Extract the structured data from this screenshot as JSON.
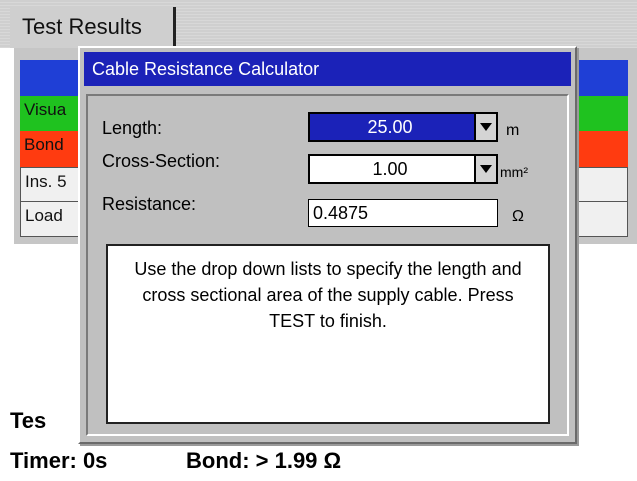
{
  "tab": {
    "label": "Test Results"
  },
  "background_rows": [
    {
      "label": ""
    },
    {
      "label": "Visua"
    },
    {
      "label": "Bond"
    },
    {
      "label": "Ins. 5"
    },
    {
      "label": "Load"
    }
  ],
  "status": {
    "test": "Tes",
    "timer": "Timer: 0s",
    "bond": "Bond: > 1.99 Ω"
  },
  "dialog": {
    "title": "Cable Resistance Calculator",
    "length": {
      "label": "Length:",
      "value": "25.00",
      "unit": "m"
    },
    "cross_section": {
      "label": "Cross-Section:",
      "value": "1.00",
      "unit": "mm²"
    },
    "resistance": {
      "label": "Resistance:",
      "value": "0.4875",
      "unit": "Ω"
    },
    "info": "Use the drop down lists to specify the length and cross sectional area of the supply cable.  Press TEST to finish."
  },
  "colors": {
    "title_bar": "#1b22b8",
    "selected_dropdown": "#1b22b8",
    "row_blue": "#1f3fd6",
    "row_green": "#1fc21f",
    "row_red": "#ff3b10"
  }
}
